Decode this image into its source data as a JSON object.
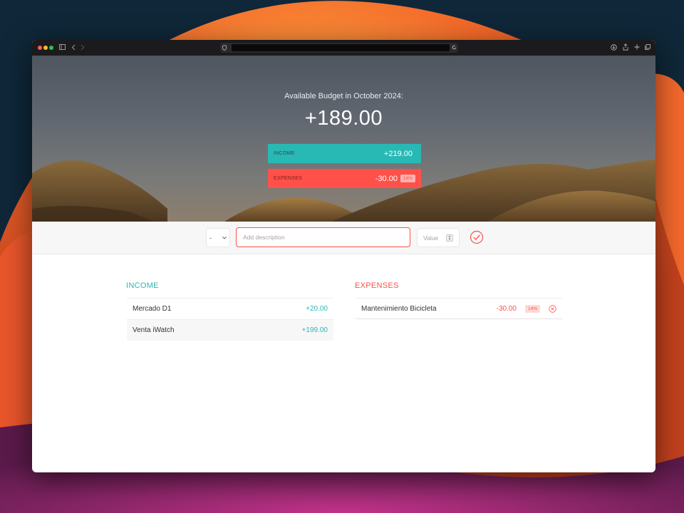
{
  "browser": {
    "back_icon": "chevron-left-icon",
    "forward_icon": "chevron-right-icon",
    "sidebar_icon": "sidebar-icon",
    "shield_icon": "privacy-shield-icon",
    "reload_icon": "reload-icon",
    "download_icon": "download-icon",
    "share_icon": "share-icon",
    "new_tab_icon": "plus-icon",
    "tabs_icon": "tabs-overview-icon"
  },
  "header": {
    "title": "Available Budget in October 2024:",
    "total": "+189.00",
    "income": {
      "label": "Income",
      "value": "+219.00"
    },
    "expenses": {
      "label": "Expenses",
      "value": "-30.00",
      "percentage": "14%"
    }
  },
  "add_form": {
    "type_selected": "-",
    "description_placeholder": "Add description",
    "value_placeholder": "Value",
    "submit_icon": "check-circle-icon"
  },
  "income": {
    "title": "Income",
    "items": [
      {
        "description": "Mercado D1",
        "value": "+20.00"
      },
      {
        "description": "Venta iWatch",
        "value": "+199.00"
      }
    ]
  },
  "expenses": {
    "title": "Expenses",
    "items": [
      {
        "description": "Mantenimiento Bicicleta",
        "value": "-30.00",
        "percentage": "14%",
        "delete_icon": "close-circle-icon"
      }
    ]
  },
  "colors": {
    "income_accent": "#28b9b5",
    "expense_accent": "#ff5049"
  }
}
